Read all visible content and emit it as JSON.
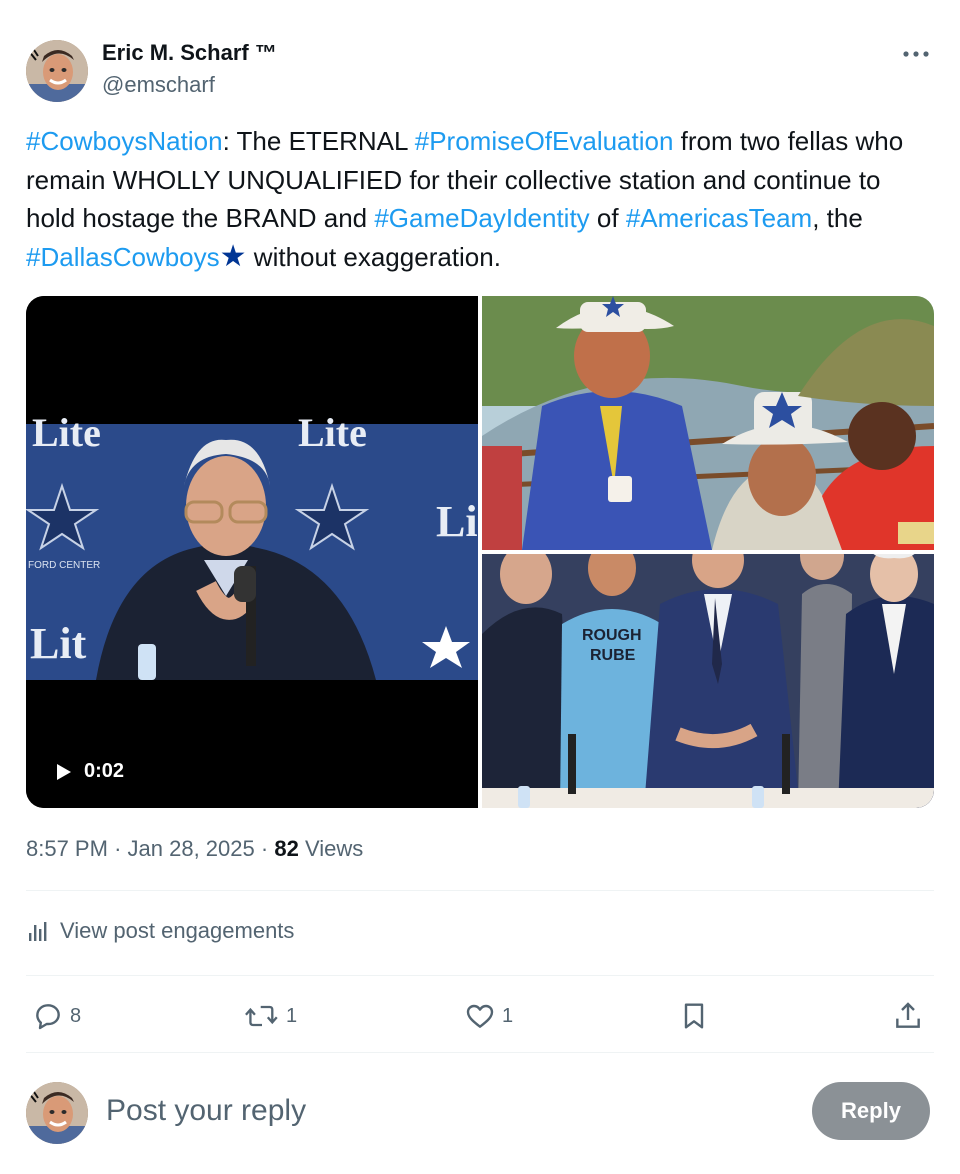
{
  "author": {
    "name": "Eric M. Scharf ™",
    "handle": "@emscharf"
  },
  "tweet": {
    "segments": [
      {
        "text": "#CowboysNation",
        "hashtag": true
      },
      {
        "text": ": The ETERNAL ",
        "hashtag": false
      },
      {
        "text": "#PromiseOfEvaluation",
        "hashtag": true
      },
      {
        "text": " from two fellas who remain WHOLLY UNQUALIFIED for their collective station and continue to hold hostage the BRAND and ",
        "hashtag": false
      },
      {
        "text": "#GameDayIdentity",
        "hashtag": true
      },
      {
        "text": " of ",
        "hashtag": false
      },
      {
        "text": "#AmericasTeam",
        "hashtag": true
      },
      {
        "text": ", the ",
        "hashtag": false
      },
      {
        "text": "#DallasCowboys",
        "hashtag": true
      },
      {
        "text": "★",
        "emoji": true
      },
      {
        "text": " without exaggeration.",
        "hashtag": false
      }
    ]
  },
  "media": {
    "video_duration": "0:02",
    "video_backdrop_text": "Lite",
    "video_backdrop_sub": "FORD CENTER",
    "shirt_text_1": "ROUGH",
    "shirt_text_2": "RUBE"
  },
  "meta": {
    "time": "8:57 PM",
    "date": "Jan 28, 2025",
    "views_count": "82",
    "views_label": "Views"
  },
  "engagements_label": "View post engagements",
  "actions": {
    "replies": "8",
    "reposts": "1",
    "likes": "1"
  },
  "reply": {
    "placeholder": "Post your reply",
    "button_label": "Reply"
  },
  "colors": {
    "link": "#1d9bf0",
    "text": "#0f1419",
    "secondary": "#536471",
    "reply_button": "#8b9196",
    "cowboys_blue": "#003594"
  }
}
